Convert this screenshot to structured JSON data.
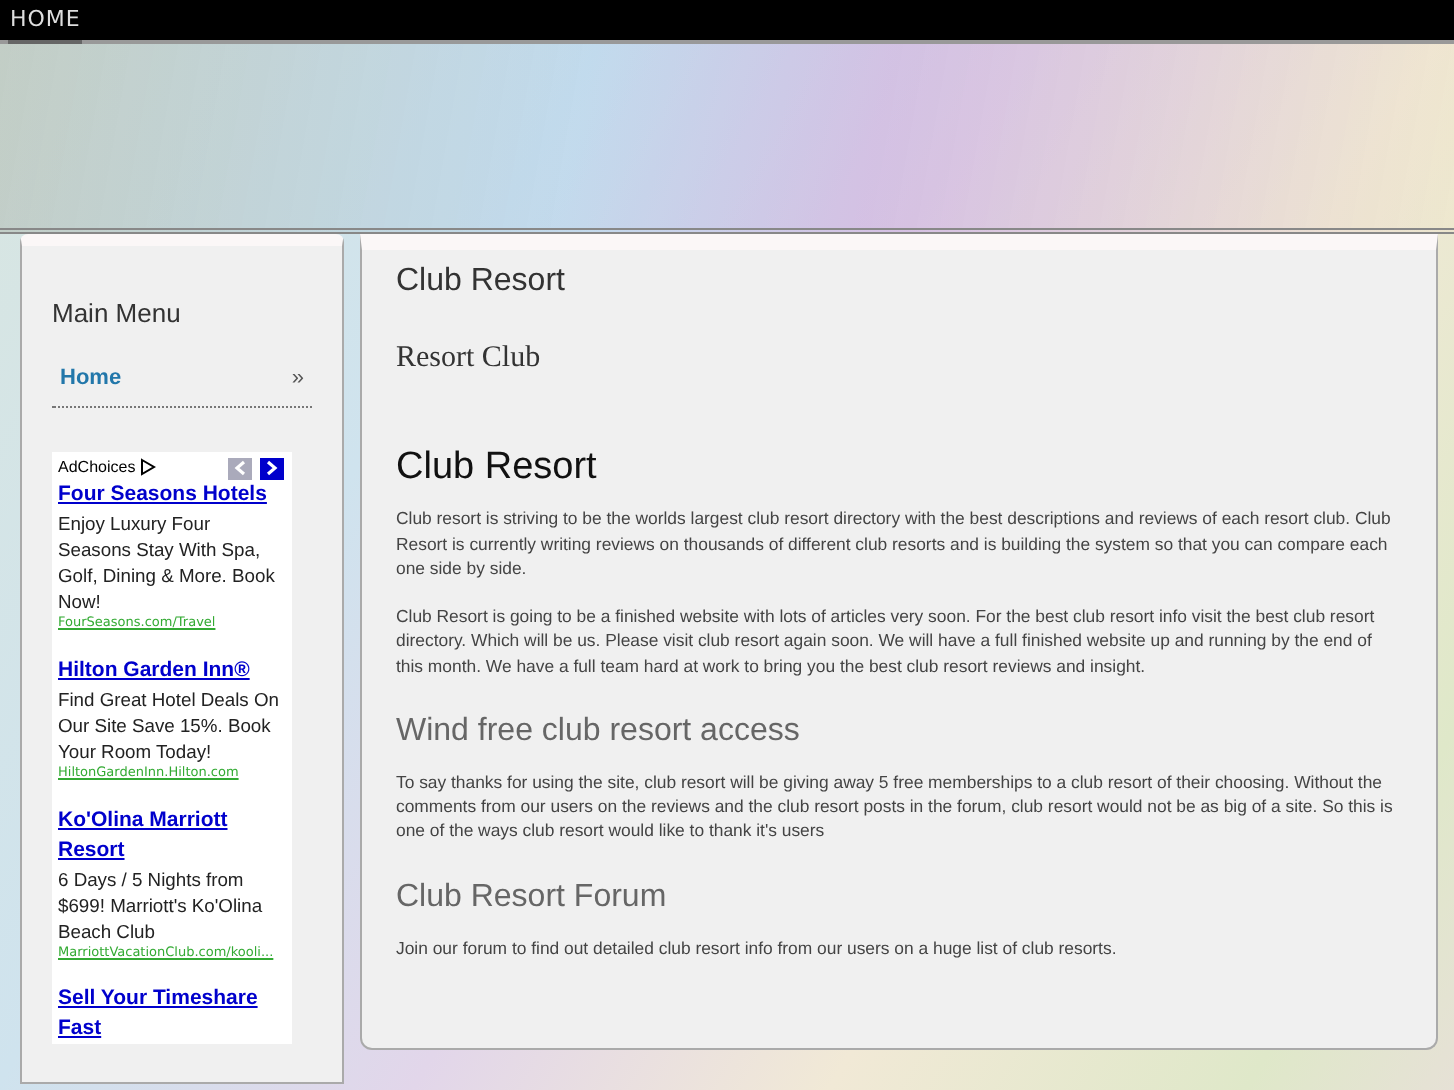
{
  "top_nav": [
    {
      "label": "HOME",
      "selected": true
    }
  ],
  "sidebar": {
    "title": "Main Menu",
    "items": [
      {
        "label": "Home",
        "arrow": "»"
      }
    ],
    "ads": {
      "label": "AdChoices",
      "items": [
        {
          "title": "Four Seasons Hotels",
          "text": "Enjoy Luxury Four Seasons Stay With Spa, Golf, Dining & More. Book Now!",
          "url": "FourSeasons.com/Travel"
        },
        {
          "title": "Hilton Garden Inn®",
          "text": "Find Great Hotel Deals On Our Site Save 15%. Book Your Room Today!",
          "url": "HiltonGardenInn.Hilton.com"
        },
        {
          "title": "Ko'Olina Marriott Resort",
          "text": "6 Days / 5 Nights from $699! Marriott's Ko'Olina Beach Club",
          "url": "MarriottVacationClub.com/kooli..."
        },
        {
          "title": "Sell Your Timeshare Fast"
        }
      ]
    }
  },
  "content": {
    "page_title": "Club Resort",
    "logo_text": "Resort Club",
    "heading": "Club Resort",
    "paragraphs": [
      "Club resort is striving to be the worlds largest club resort directory with the best descriptions and reviews of each resort club. Club Resort is currently writing reviews on thousands of different club resorts and is building the system so that you can compare each one side by side.",
      "Club Resort is going to be a finished website with lots of articles very soon. For the best club resort info visit the best club resort directory. Which will be us. Please visit club resort again soon. We will have a full finished website up and running by the end of this month. We have a full team hard at work to bring you the best club resort reviews and insight."
    ],
    "sections": [
      {
        "heading": "Wind free club resort access",
        "text": "To say thanks for using the site, club resort will be giving away 5 free memberships to a club resort of their choosing. Without the comments from our users on the reviews and the club resort posts in the forum, club resort would not be as big of a site. So this is one of the ways club resort would like to thank it's users"
      },
      {
        "heading": "Club Resort Forum",
        "text": "Join our forum to find out detailed club resort info from our users on a huge list of club resorts."
      }
    ]
  }
}
